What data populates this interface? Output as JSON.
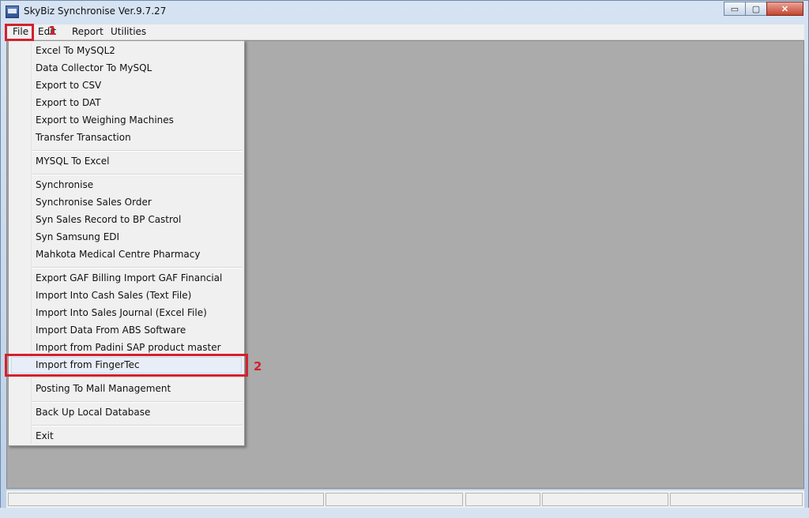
{
  "window": {
    "title": "SkyBiz Synchronise Ver.9.7.27",
    "controls": {
      "minimize": "▭",
      "maximize": "▢",
      "close": "✕"
    }
  },
  "menubar": {
    "items": [
      {
        "label": "File"
      },
      {
        "label": "Edit"
      },
      {
        "label": "Report"
      },
      {
        "label": "Utilities"
      }
    ]
  },
  "file_menu": {
    "items": [
      "Excel To MySQL2",
      "Data Collector To MySQL",
      "Export to CSV",
      "Export to DAT",
      "Export to Weighing Machines",
      "Transfer Transaction",
      "MYSQL To Excel",
      "Synchronise",
      "Synchronise Sales Order",
      "Syn Sales Record to BP Castrol",
      "Syn Samsung EDI",
      "Mahkota Medical Centre Pharmacy",
      "Export GAF Billing  Import GAF Financial",
      "Import Into Cash Sales (Text File)",
      "Import Into Sales Journal (Excel File)",
      "Import Data From ABS Software",
      "Import from Padini SAP product master",
      "Import from FingerTec",
      "Posting To Mall Management",
      "Back Up Local Database",
      "Exit"
    ]
  },
  "annotations": {
    "step1": "1",
    "step2": "2",
    "color": "#d3212c"
  }
}
